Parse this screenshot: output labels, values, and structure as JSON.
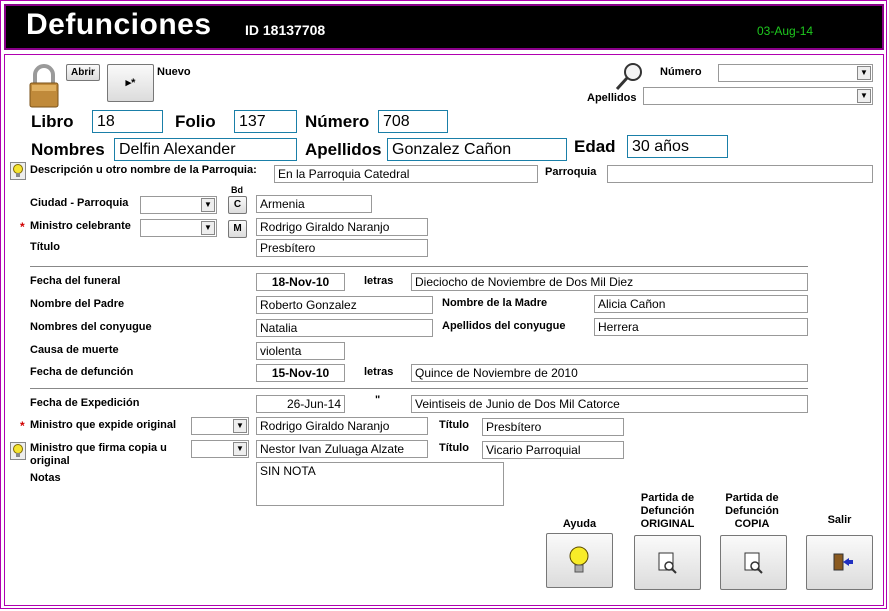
{
  "header": {
    "title": "Defunciones",
    "id_label": "ID",
    "id_value": "18137708",
    "date": "03-Aug-14"
  },
  "toolbar": {
    "abrir": "Abrir",
    "nuevo": "Nuevo",
    "nuevo_btn_text": "▸*"
  },
  "search": {
    "numero_label": "Número",
    "apellidos_label": "Apellidos",
    "numero_value": "",
    "apellidos_value": ""
  },
  "record": {
    "libro_label": "Libro",
    "libro": "18",
    "folio_label": "Folio",
    "folio": "137",
    "numero_label": "Número",
    "numero": "708",
    "nombres_label": "Nombres",
    "nombres": "Delfin Alexander",
    "apellidos_label": "Apellidos",
    "apellidos": "Gonzalez Cañon",
    "edad_label": "Edad",
    "edad": "30 años"
  },
  "parish": {
    "descripcion_label": "Descripción u otro nombre de la Parroquia:",
    "descripcion": "En la Parroquia Catedral",
    "parroquia_label": "Parroquia",
    "parroquia": "",
    "bd_label": "Bd",
    "ciudad_label": "Ciudad - Parroquia",
    "c_btn": "C",
    "ciudad": "Armenia",
    "ministro_label": "Ministro celebrante",
    "m_btn": "M",
    "ministro": "Rodrigo Giraldo Naranjo",
    "titulo_label": "Título",
    "titulo": "Presbítero"
  },
  "funeral": {
    "fecha_funeral_label": "Fecha del funeral",
    "fecha_funeral": "18-Nov-10",
    "letras_label": "letras",
    "fecha_funeral_letras": "Dieciocho de Noviembre de Dos Mil Diez",
    "padre_label": "Nombre del Padre",
    "padre": "Roberto Gonzalez",
    "madre_label": "Nombre de la Madre",
    "madre": "Alicia Cañon",
    "conyugue_label": "Nombres del conyugue",
    "conyugue": "Natalia",
    "ap_conyugue_label": "Apellidos del conyugue",
    "ap_conyugue": "Herrera",
    "causa_label": "Causa de muerte",
    "causa": "violenta",
    "fecha_defuncion_label": "Fecha de defunción",
    "fecha_defuncion": "15-Nov-10",
    "letras2_label": "letras",
    "fecha_defuncion_letras": "Quince de Noviembre de 2010"
  },
  "expedicion": {
    "fecha_label": "Fecha de Expedición",
    "fecha": "26-Jun-14",
    "quote": "\"",
    "fecha_letras": "Veintiseis de Junio de Dos Mil Catorce",
    "ministro_exp_label": "Ministro que expide original",
    "ministro_exp": "Rodrigo Giraldo Naranjo",
    "titulo_exp_label": "Título",
    "titulo_exp": "Presbítero",
    "ministro_firma_label_1": "Ministro que firma copia u",
    "ministro_firma_label_2": "original",
    "ministro_firma": "Nestor Ivan Zuluaga Alzate",
    "titulo_firma_label": "Título",
    "titulo_firma": "Vicario Parroquial",
    "notas_label": "Notas",
    "notas": "SIN NOTA"
  },
  "actions": {
    "ayuda": "Ayuda",
    "original_1": "Partida de",
    "original_2": "Defunción",
    "original_3": "ORIGINAL",
    "copia_1": "Partida de",
    "copia_2": "Defunción",
    "copia_3": "COPIA",
    "salir": "Salir"
  },
  "colors": {
    "header_bg": "#000000",
    "frame": "#b000b0",
    "date": "#1ec81e",
    "field_border": "#1a7fa8",
    "required": "#d00000"
  }
}
